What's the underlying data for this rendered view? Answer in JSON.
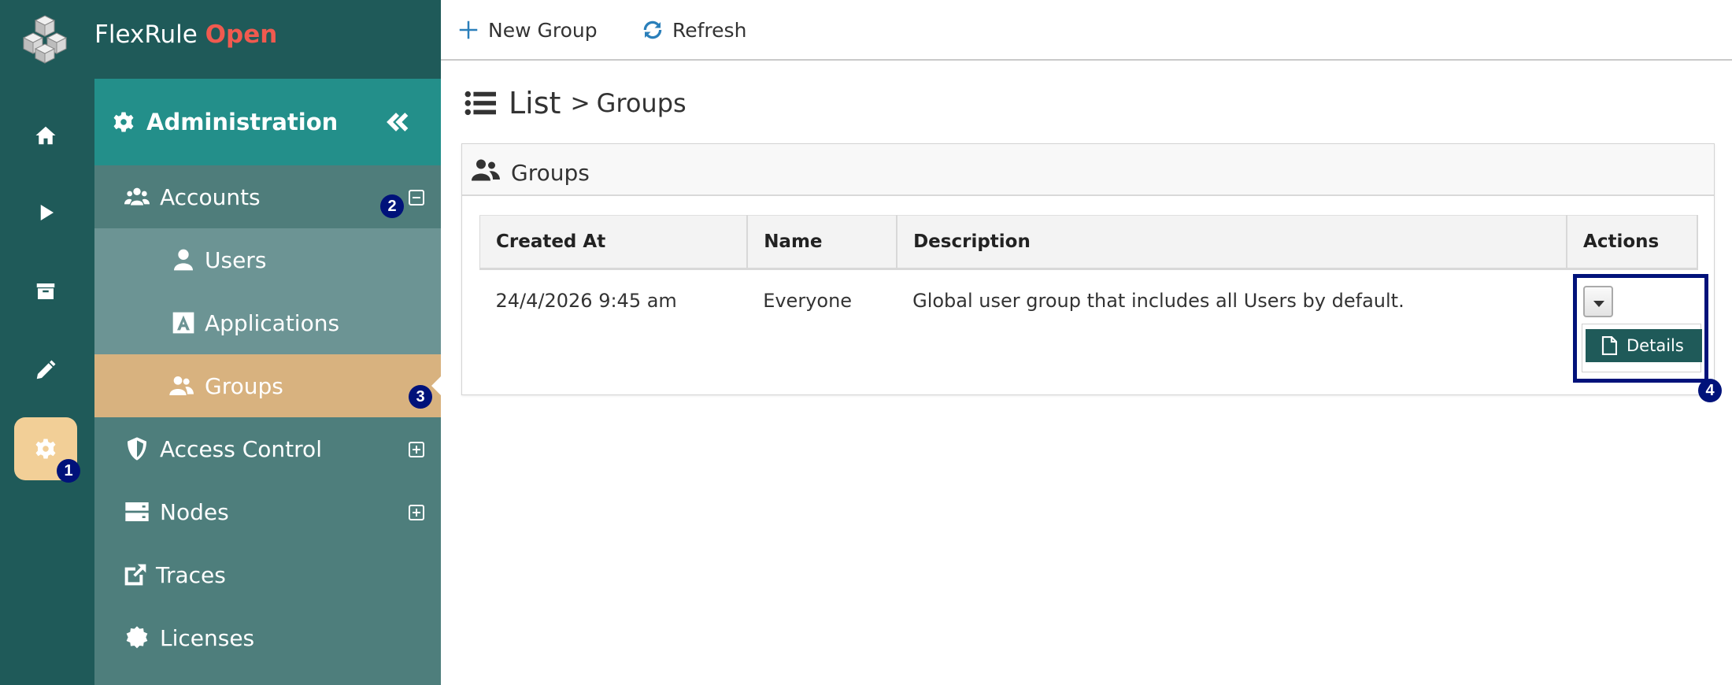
{
  "brand": {
    "name": "FlexRule",
    "highlight": "Open"
  },
  "rail": [
    {
      "icon": "home-icon",
      "active": false
    },
    {
      "icon": "play-icon",
      "active": false
    },
    {
      "icon": "archive-icon",
      "active": false
    },
    {
      "icon": "pencil-icon",
      "active": false
    },
    {
      "icon": "gear-icon",
      "active": true
    }
  ],
  "sidebar": {
    "header": "Administration",
    "items": {
      "accounts": "Accounts",
      "users": "Users",
      "applications": "Applications",
      "groups": "Groups",
      "access_control": "Access Control",
      "nodes": "Nodes",
      "traces": "Traces",
      "licenses": "Licenses"
    }
  },
  "badges": [
    "1",
    "2",
    "3",
    "4"
  ],
  "toolbar": {
    "new_group": "New Group",
    "refresh": "Refresh"
  },
  "breadcrumb": {
    "root": "List",
    "separator": ">",
    "current": "Groups"
  },
  "panel": {
    "title": "Groups"
  },
  "table": {
    "columns": [
      "Created At",
      "Name",
      "Description",
      "Actions"
    ],
    "rows": [
      {
        "created_at": "24/4/2026 9:45 am",
        "name": "Everyone",
        "description": "Global user group that includes all Users by default."
      }
    ]
  },
  "actions_menu": {
    "details": "Details"
  },
  "colors": {
    "brand_dark": "#1f5a59",
    "accent_teal": "#238f8a",
    "selected": "#d8b27f",
    "brand_open": "#f05a4f",
    "badge": "#00127a"
  }
}
